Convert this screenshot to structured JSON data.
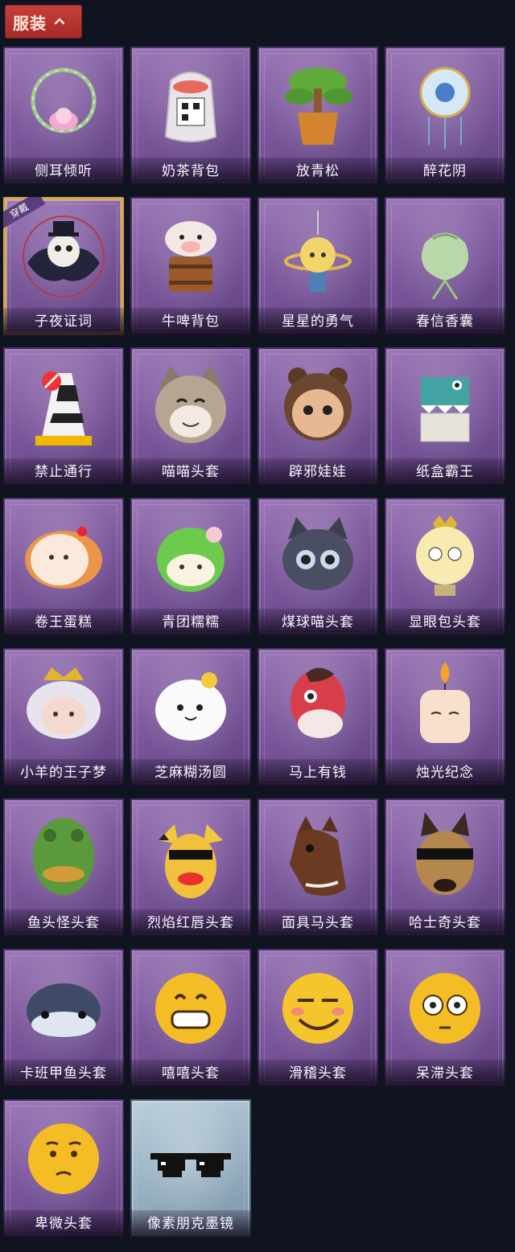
{
  "header": {
    "title": "服装",
    "chevron_icon": "chevron-up-icon",
    "color": "#b2302c"
  },
  "badge_text": "穿戴",
  "items": [
    {
      "label": "侧耳倾听",
      "icon": "lotus-wreath-icon",
      "style": "purple"
    },
    {
      "label": "奶茶背包",
      "icon": "milk-tea-bag-icon",
      "style": "purple"
    },
    {
      "label": "放青松",
      "icon": "bonsai-pine-icon",
      "style": "purple"
    },
    {
      "label": "醉花阴",
      "icon": "flower-pendant-icon",
      "style": "purple"
    },
    {
      "label": "子夜证词",
      "icon": "raven-doll-icon",
      "style": "purple",
      "equipped": true
    },
    {
      "label": "牛啤背包",
      "icon": "cow-beer-barrel-icon",
      "style": "purple"
    },
    {
      "label": "星星的勇气",
      "icon": "star-doll-pendant-icon",
      "style": "purple"
    },
    {
      "label": "春信香囊",
      "icon": "sachet-icon",
      "style": "purple"
    },
    {
      "label": "禁止通行",
      "icon": "traffic-cone-icon",
      "style": "purple"
    },
    {
      "label": "喵喵头套",
      "icon": "cat-head-icon",
      "style": "purple"
    },
    {
      "label": "辟邪娃娃",
      "icon": "doll-head-icon",
      "style": "purple"
    },
    {
      "label": "纸盒霸王",
      "icon": "box-dinosaur-icon",
      "style": "purple"
    },
    {
      "label": "卷王蛋糕",
      "icon": "roll-cake-icon",
      "style": "purple"
    },
    {
      "label": "青团糯糯",
      "icon": "green-rice-ball-icon",
      "style": "purple"
    },
    {
      "label": "煤球喵头套",
      "icon": "black-cat-head-icon",
      "style": "purple"
    },
    {
      "label": "显眼包头套",
      "icon": "light-bulb-head-icon",
      "style": "purple"
    },
    {
      "label": "小羊的王子梦",
      "icon": "sheep-crown-head-icon",
      "style": "purple"
    },
    {
      "label": "芝麻糊汤圆",
      "icon": "dumpling-head-icon",
      "style": "purple"
    },
    {
      "label": "马上有钱",
      "icon": "red-horse-head-icon",
      "style": "purple"
    },
    {
      "label": "烛光纪念",
      "icon": "candle-head-icon",
      "style": "purple"
    },
    {
      "label": "鱼头怪头套",
      "icon": "fish-head-icon",
      "style": "purple"
    },
    {
      "label": "烈焰红唇头套",
      "icon": "red-lips-head-icon",
      "style": "purple"
    },
    {
      "label": "面具马头套",
      "icon": "horse-mask-icon",
      "style": "purple"
    },
    {
      "label": "哈士奇头套",
      "icon": "husky-head-icon",
      "style": "purple"
    },
    {
      "label": "卡班甲鱼头套",
      "icon": "whale-head-icon",
      "style": "purple"
    },
    {
      "label": "嘻嘻头套",
      "icon": "grin-emoji-icon",
      "style": "purple"
    },
    {
      "label": "滑稽头套",
      "icon": "smirk-emoji-icon",
      "style": "purple"
    },
    {
      "label": "呆滞头套",
      "icon": "stunned-emoji-icon",
      "style": "purple"
    },
    {
      "label": "卑微头套",
      "icon": "humble-emoji-icon",
      "style": "purple"
    },
    {
      "label": "像素朋克墨镜",
      "icon": "pixel-sunglasses-icon",
      "style": "blue"
    }
  ]
}
